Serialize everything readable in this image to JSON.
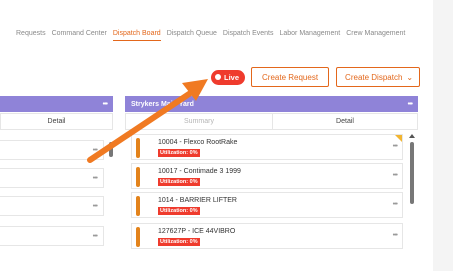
{
  "nav": {
    "items": [
      "Requests",
      "Command Center",
      "Dispatch Board",
      "Dispatch Queue",
      "Dispatch Events",
      "Labor Management",
      "Crew Management"
    ],
    "active_index": 2
  },
  "toolbar": {
    "live_label": "Live",
    "create_request_label": "Create Request",
    "create_dispatch_label": "Create Dispatch"
  },
  "left_column": {
    "subheader_label": "Detail",
    "menu_dots": "•••"
  },
  "right_column": {
    "title": "Strykers Main Yard",
    "menu_dots": "•••",
    "summary_label": "Summary",
    "detail_label": "Detail",
    "cards": [
      {
        "title": "10004 - Flexco RootRake",
        "badge": "Utilization: 0%"
      },
      {
        "title": "10017 - Contimade 3 1999",
        "badge": "Utilization: 0%"
      },
      {
        "title": "1014 - BARRIER LIFTER",
        "badge": "Utilization: 0%"
      },
      {
        "title": "127627P - ICE 44VIBRO",
        "badge": "Utilization: 0%"
      }
    ]
  },
  "colors": {
    "accent": "#e3671b",
    "live": "#ef3b2d",
    "column_header": "#8f83d8",
    "card_bar": "#e3831b",
    "annotation_arrow": "#f07a22"
  },
  "icons": {
    "live": "live-dot-icon",
    "dispatch_dropdown": "chevron-down-icon",
    "menu": "more-dots-icon",
    "annotation": "annotation-arrow"
  }
}
